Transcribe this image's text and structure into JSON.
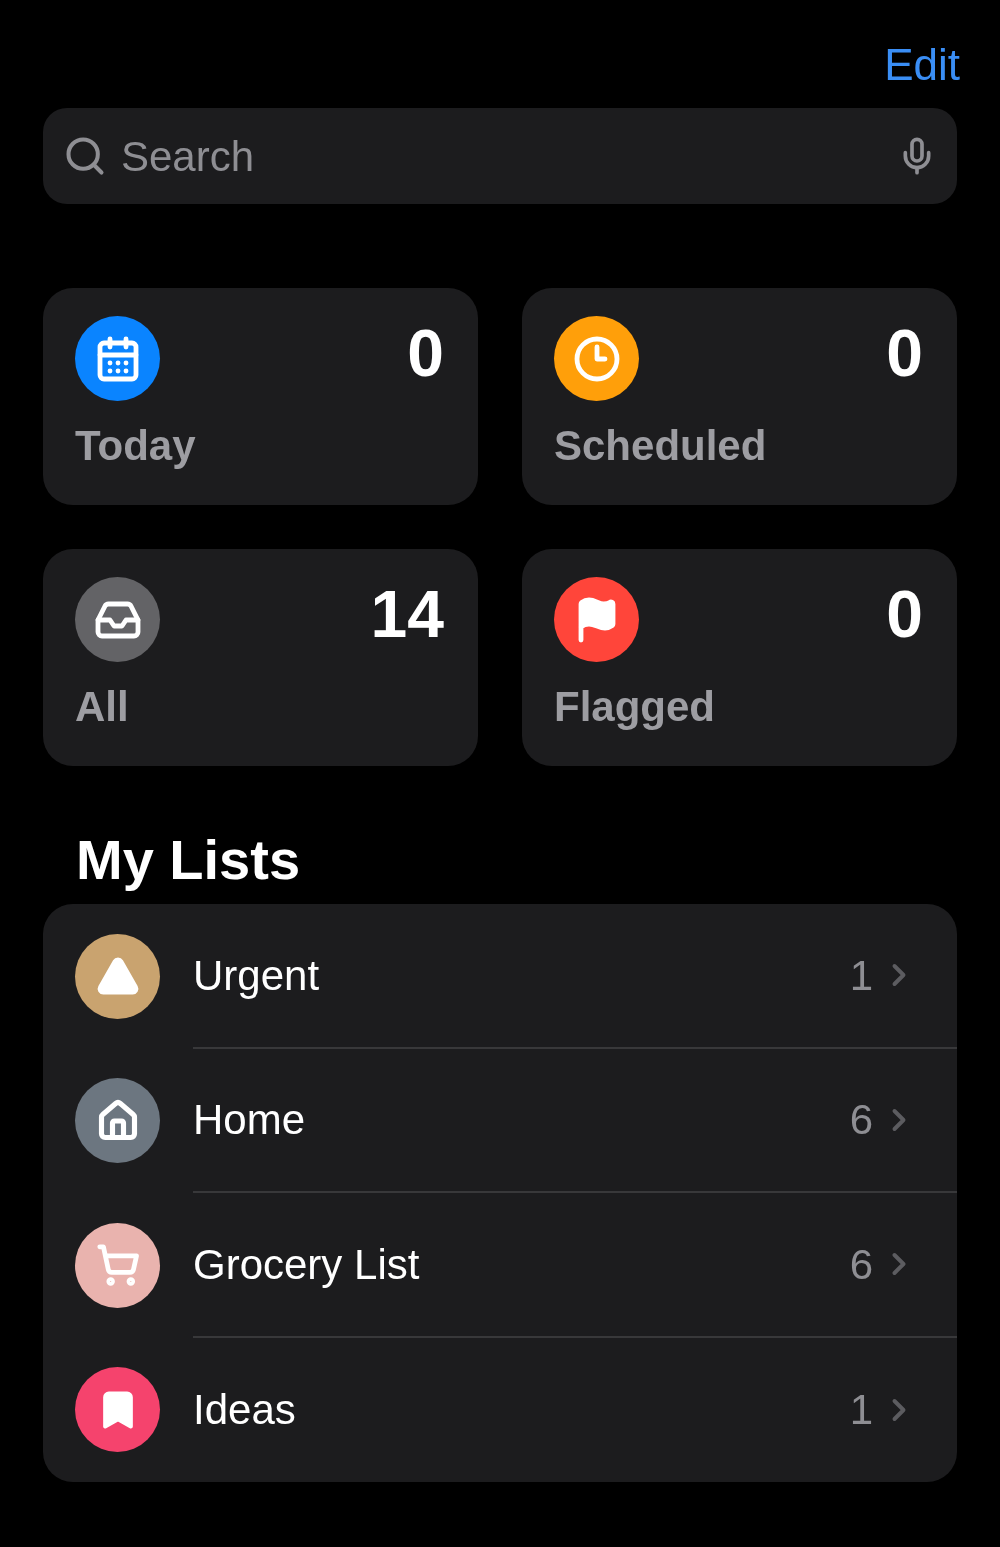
{
  "nav": {
    "edit": "Edit"
  },
  "search": {
    "placeholder": "Search"
  },
  "smart_lists": [
    {
      "kind": "today",
      "label": "Today",
      "count": "0",
      "color": "#0a84ff"
    },
    {
      "kind": "scheduled",
      "label": "Scheduled",
      "count": "0",
      "color": "#ff9f0a"
    },
    {
      "kind": "all",
      "label": "All",
      "count": "14",
      "color": "#636366"
    },
    {
      "kind": "flagged",
      "label": "Flagged",
      "count": "0",
      "color": "#ff453a"
    }
  ],
  "my_lists": {
    "title": "My Lists",
    "items": [
      {
        "kind": "warning",
        "name": "Urgent",
        "count": "1",
        "color": "#c9a36f"
      },
      {
        "kind": "home",
        "name": "Home",
        "count": "6",
        "color": "#6c7680"
      },
      {
        "kind": "cart",
        "name": "Grocery List",
        "count": "6",
        "color": "#e9b3ae"
      },
      {
        "kind": "bookmark",
        "name": "Ideas",
        "count": "1",
        "color": "#f5436d"
      }
    ]
  }
}
